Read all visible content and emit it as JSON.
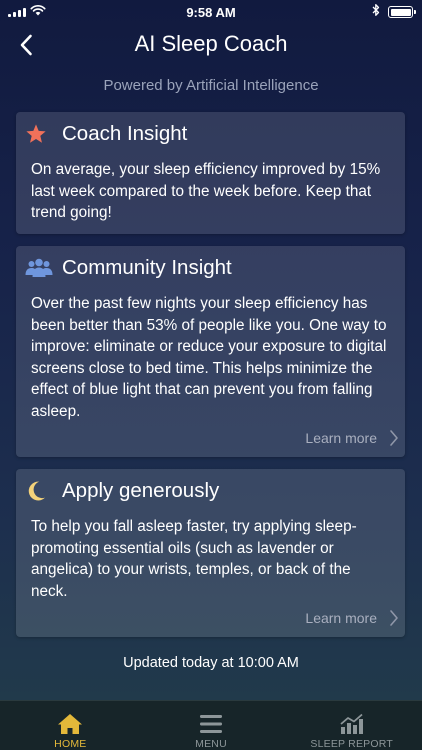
{
  "status_bar": {
    "time": "9:58 AM",
    "icons": [
      "signal-icon",
      "wifi-icon",
      "bluetooth-icon",
      "battery-icon"
    ]
  },
  "nav": {
    "title": "AI Sleep Coach",
    "back_icon": "chevron-left-icon"
  },
  "subtitle": "Powered by Artificial Intelligence",
  "cards": [
    {
      "icon": "star-icon",
      "icon_color": "#f0715a",
      "title": "Coach Insight",
      "body": "On average, your sleep efficiency improved by 15% last week compared to the week before. Keep that trend going!"
    },
    {
      "icon": "people-icon",
      "icon_color": "#6f96dd",
      "title": "Community Insight",
      "body": "Over the past few nights your sleep efficiency has been better than 53% of people like you. One way to improve: eliminate or reduce your exposure to digital screens close to bed time. This helps minimize the effect of blue light that can prevent you from falling asleep.",
      "link_label": "Learn more"
    },
    {
      "icon": "moon-icon",
      "icon_color": "#f3d27a",
      "title": "Apply generously",
      "body": "To help you fall asleep faster, try applying sleep-promoting essential oils (such as lavender or angelica) to your wrists, temples, or back of the neck.",
      "link_label": "Learn more"
    }
  ],
  "updated_text": "Updated today at 10:00 AM",
  "tabs": [
    {
      "label": "HOME",
      "icon": "home-icon",
      "active": true
    },
    {
      "label": "MENU",
      "icon": "hamburger-menu-icon",
      "active": false
    },
    {
      "label": "SLEEP REPORT",
      "icon": "bar-chart-icon",
      "active": false
    }
  ],
  "colors": {
    "accent": "#e3b83a",
    "inactive_tab": "#8d9699",
    "subtitle": "#9aa3ba"
  }
}
